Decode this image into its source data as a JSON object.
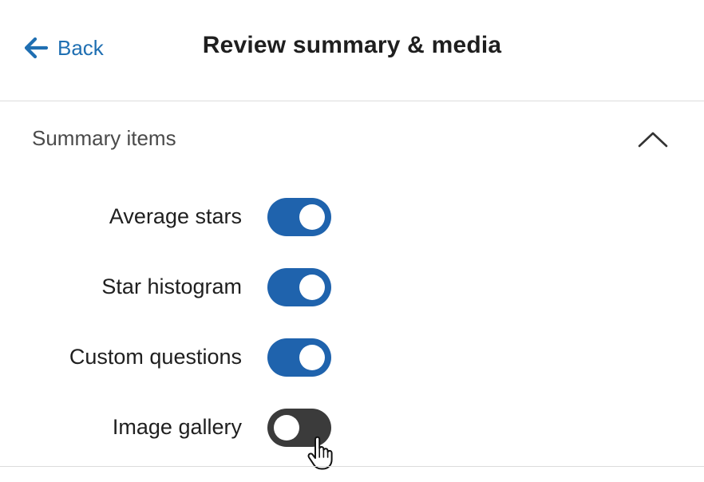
{
  "header": {
    "back_label": "Back",
    "title": "Review summary & media"
  },
  "section": {
    "title": "Summary items",
    "expanded": true
  },
  "items": [
    {
      "label": "Average stars",
      "enabled": true
    },
    {
      "label": "Star histogram",
      "enabled": true
    },
    {
      "label": "Custom questions",
      "enabled": true
    },
    {
      "label": "Image gallery",
      "enabled": false
    }
  ],
  "colors": {
    "accent": "#1f6fb2",
    "toggle_on": "#1f63ad",
    "toggle_off": "#3b3b3b"
  },
  "icons": {
    "back": "arrow-left-icon",
    "section": "chevron-up-icon",
    "cursor": "hand-pointer-icon"
  }
}
